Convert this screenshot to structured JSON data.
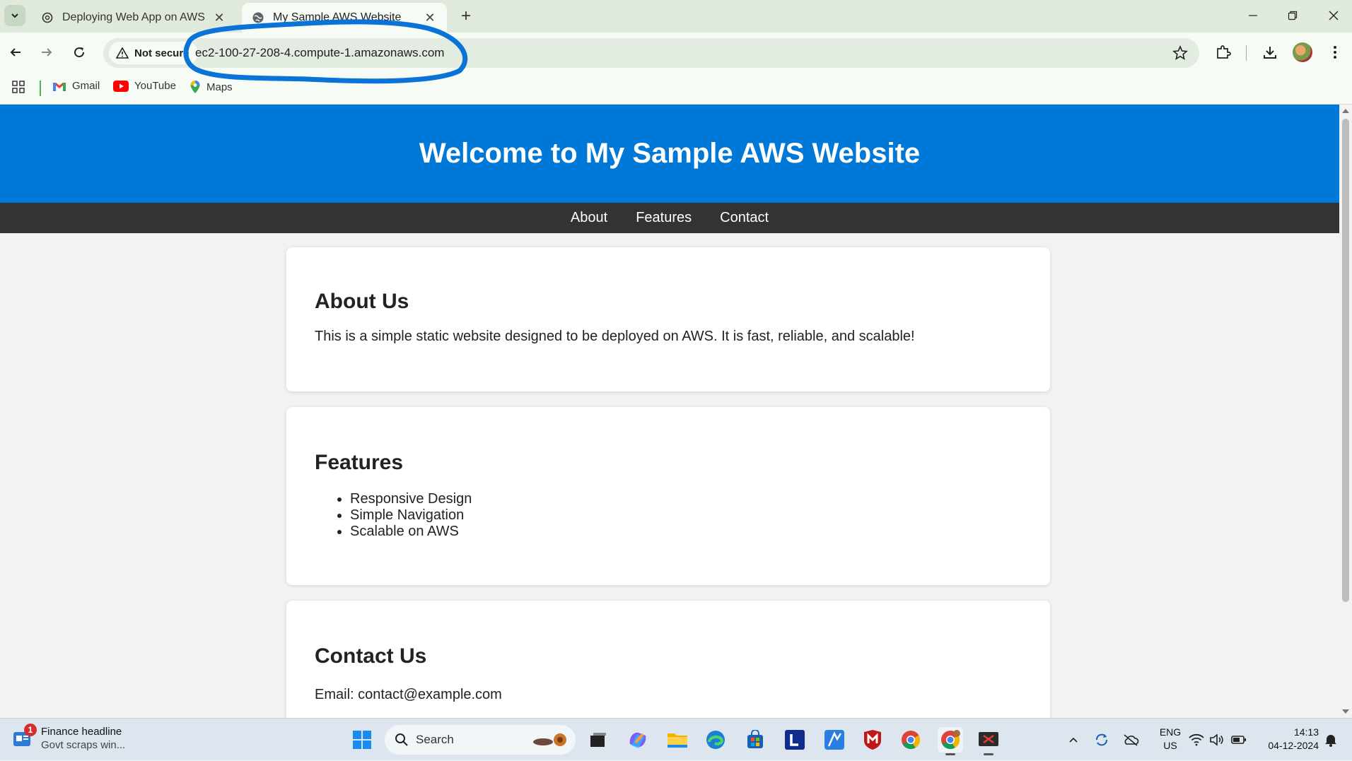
{
  "browser": {
    "tabs": [
      {
        "title": "Deploying Web App on AWS",
        "active": false,
        "favicon": "openai-icon"
      },
      {
        "title": "My Sample AWS Website",
        "active": true,
        "favicon": "globe-icon"
      }
    ],
    "security_label": "Not secure",
    "url": "ec2-100-27-208-4.compute-1.amazonaws.com",
    "bookmarks": [
      {
        "label": "Gmail",
        "icon": "gmail-icon"
      },
      {
        "label": "YouTube",
        "icon": "youtube-icon"
      },
      {
        "label": "Maps",
        "icon": "maps-icon"
      }
    ],
    "annotation_color": "#0a73d8"
  },
  "site": {
    "header_title": "Welcome to My Sample AWS Website",
    "nav": [
      "About",
      "Features",
      "Contact"
    ],
    "about": {
      "heading": "About Us",
      "text": "This is a simple static website designed to be deployed on AWS. It is fast, reliable, and scalable!"
    },
    "features": {
      "heading": "Features",
      "items": [
        "Responsive Design",
        "Simple Navigation",
        "Scalable on AWS"
      ]
    },
    "contact": {
      "heading": "Contact Us",
      "email_text": "Email: contact@example.com"
    },
    "colors": {
      "header": "#0078d7",
      "nav": "#333333",
      "background": "#f2f2f2"
    }
  },
  "taskbar": {
    "news": {
      "badge": "1",
      "title": "Finance headline",
      "subtitle": "Govt scraps win..."
    },
    "search_placeholder": "Search",
    "lang_line1": "ENG",
    "lang_line2": "US",
    "time": "14:13",
    "date": "04-12-2024"
  }
}
